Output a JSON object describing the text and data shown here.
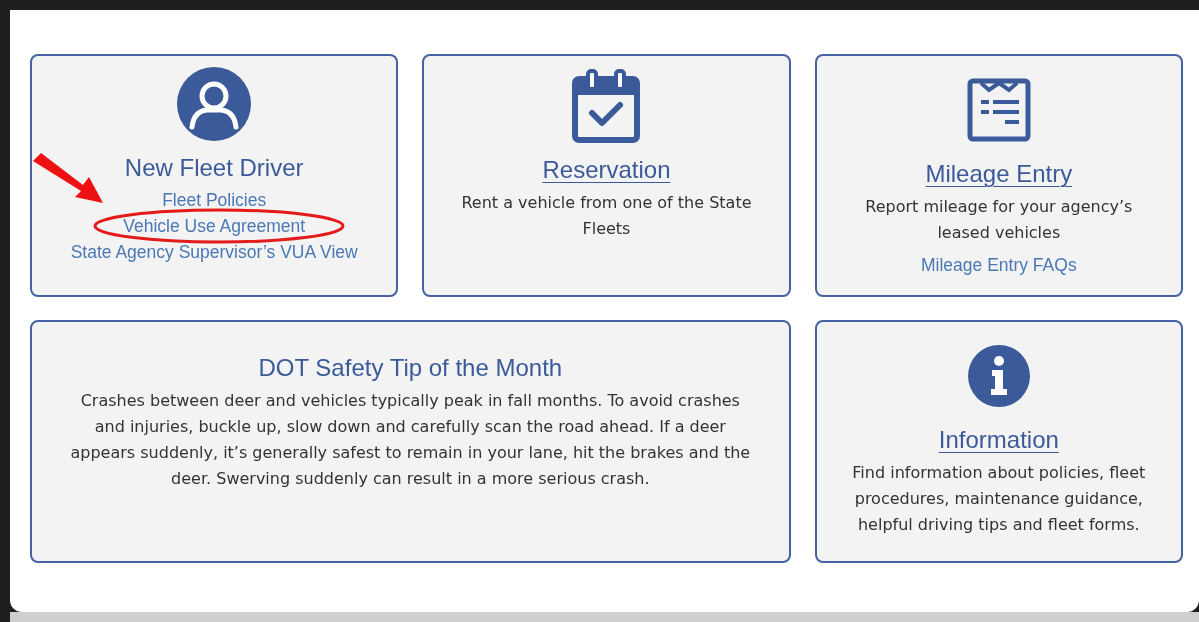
{
  "cards": [
    {
      "kind": "driver",
      "title": {
        "text": "New Fleet Driver",
        "link": false
      },
      "links": [
        {
          "text": "Fleet Policies",
          "circled": false
        },
        {
          "text": "Vehicle Use Agreement",
          "circled": true
        },
        {
          "text": "State Agency Supervisor’s VUA View",
          "circled": false
        }
      ]
    },
    {
      "kind": "reservation",
      "title": {
        "text": "Reservation",
        "link": true
      },
      "description": "Rent a vehicle from one of the State Fleets"
    },
    {
      "kind": "mileage",
      "title": {
        "text": "Mileage Entry",
        "link": true
      },
      "description": "Report mileage for your agency’s leased vehicles",
      "links": [
        {
          "text": "Mileage Entry FAQs",
          "circled": false
        }
      ]
    },
    {
      "kind": "tip",
      "title": {
        "text": "DOT Safety Tip of the Month",
        "link": false
      },
      "description": "Crashes between deer and vehicles typically peak in fall months. To avoid crashes and injuries, buckle up, slow down and carefully scan the road ahead. If a deer appears suddenly, it’s generally safest to remain in your lane, hit the brakes and the deer. Swerving suddenly can result in a more serious crash."
    },
    {
      "kind": "information",
      "title": {
        "text": "Information",
        "link": true
      },
      "description": "Find information about policies, fleet procedures, maintenance guidance, helpful driving tips and fleet forms."
    }
  ]
}
